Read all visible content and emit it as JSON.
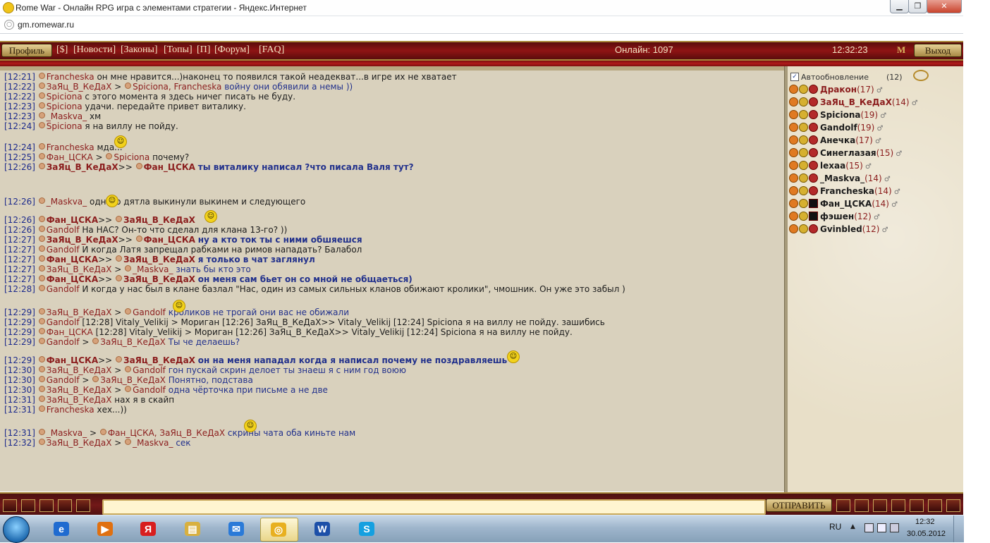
{
  "window": {
    "title": "Rome War - Онлайн RPG игра с элементами стратегии - Яндекс.Интернет",
    "min_label": "▁",
    "max_label": "❐",
    "close_label": "✕"
  },
  "address": {
    "url": "gm.romewar.ru"
  },
  "menu": {
    "profile_label": "Профиль",
    "items": [
      "[$]",
      "[Новости]",
      "[Законы]",
      "[Топы]",
      "[П]",
      "[Форум]",
      "[FAQ]"
    ],
    "online": "Онлайн: 1097",
    "clock": "12:32:23",
    "logo": "M",
    "exit_label": "Выход"
  },
  "chat": {
    "messages": [
      {
        "ts": "[12:21]",
        "from": "Francheska",
        "to": "",
        "text": "он мне нравится...)наконец то появился такой неадекват...в игре их не хватает",
        "style": "plain"
      },
      {
        "ts": "[12:22]",
        "from": "ЗаЯц_В_КеДаХ",
        "to": "Spiciona, Francheska",
        "text": "войну они обявили а немы ))",
        "style": "blue"
      },
      {
        "ts": "[12:22]",
        "from": "Spiciona",
        "to": "",
        "text": "с этого момента я здесь ничег писать не буду.",
        "style": "plain"
      },
      {
        "ts": "[12:23]",
        "from": "Spiciona",
        "to": "",
        "text": "удачи. передайте привет виталику.",
        "style": "plain"
      },
      {
        "ts": "[12:23]",
        "from": "_Maskva_",
        "to": "",
        "text": "хм",
        "style": "plain"
      },
      {
        "ts": "[12:24]",
        "from": "Spiciona",
        "to": "",
        "text": "я на виллу не пойду.",
        "style": "plain"
      },
      {
        "ts": "[12:24]",
        "from": "Francheska",
        "to": "",
        "text": "мда...",
        "style": "plain"
      },
      {
        "ts": "[12:25]",
        "from": "Фан_ЦСКА",
        "to": "Spiciona",
        "text": "почему?",
        "style": "plain"
      },
      {
        "ts": "[12:26]",
        "from": "ЗаЯц_В_КеДаХ",
        "to": "Фан_ЦСКА",
        "text": "ты виталику написал ?что писала Валя тут?",
        "style": "bblue"
      },
      {
        "ts": "[12:26]",
        "from": "_Maskva_",
        "to": "",
        "text": "одного дятла выкинули выкинем и следующего",
        "style": "plain"
      },
      {
        "ts": "[12:26]",
        "from": "Фан_ЦСКА",
        "to": "ЗаЯц_В_КеДаХ",
        "text": "",
        "style": "bred"
      },
      {
        "ts": "[12:26]",
        "from": "Gandolf",
        "to": "",
        "text": "На НАС? Он-то что сделал для клана 13-го? ))",
        "style": "plain"
      },
      {
        "ts": "[12:27]",
        "from": "ЗаЯц_В_КеДаХ",
        "to": "Фан_ЦСКА",
        "text": "ну а кто ток ты с ними обшяешся",
        "style": "bblue"
      },
      {
        "ts": "[12:27]",
        "from": "Gandolf",
        "to": "",
        "text": "И когда Латя запрещал рабками на римов нападать? Балабол",
        "style": "plain"
      },
      {
        "ts": "[12:27]",
        "from": "Фан_ЦСКА",
        "to": "ЗаЯц_В_КеДаХ",
        "text": "я только в чат заглянул",
        "style": "bred"
      },
      {
        "ts": "[12:27]",
        "from": "ЗаЯц_В_КеДаХ",
        "to": "_Maskva_",
        "text": "знать бы кто это",
        "style": "blue"
      },
      {
        "ts": "[12:27]",
        "from": "Фан_ЦСКА",
        "to": "ЗаЯц_В_КеДаХ",
        "text": "он меня сам бьет он со мной не общаеться)",
        "style": "bblue"
      },
      {
        "ts": "[12:28]",
        "from": "Gandolf",
        "to": "",
        "text": "И когда у нас был в клане базлал \"Нас, один из самых сильных кланов обижают  кролики\", чмошник. Он уже это забыл )",
        "style": "plain"
      },
      {
        "ts": "[12:29]",
        "from": "ЗаЯц_В_КеДаХ",
        "to": "Gandolf",
        "text": "кроликов не трогай они вас не обижали",
        "style": "blue"
      },
      {
        "ts": "[12:29]",
        "from": "Gandolf",
        "to": "",
        "text": "[12:28] Vitaly_Velikij > Мориган [12:26] ЗаЯц_В_КеДаХ>>  Vitaly_Velikij [12:24] Spiciona я на виллу не пойду. зашибись",
        "style": "plain"
      },
      {
        "ts": "[12:29]",
        "from": "Фан_ЦСКА",
        "to": "",
        "text": "[12:28] Vitaly_Velikij > Мориган [12:26] ЗаЯц_В_КеДаХ>>  Vitaly_Velikij [12:24] Spiciona я на виллу не пойду.",
        "style": "plain"
      },
      {
        "ts": "[12:29]",
        "from": "Gandolf",
        "to": "ЗаЯц_В_КеДаХ",
        "text": "Ты че делаешь?",
        "style": "blue"
      },
      {
        "ts": "[12:29]",
        "from": "Фан_ЦСКА",
        "to": "ЗаЯц_В_КеДаХ",
        "text": "он на меня нападал когда я написал почему не поздравляешь",
        "style": "bred"
      },
      {
        "ts": "[12:30]",
        "from": "ЗаЯц_В_КеДаХ",
        "to": "Gandolf",
        "text": "гон пускай скрин делоет ты знаеш я с ним год воюю",
        "style": "blue"
      },
      {
        "ts": "[12:30]",
        "from": "Gandolf",
        "to": "ЗаЯц_В_КеДаХ",
        "text": "Понятно, подстава",
        "style": "blue"
      },
      {
        "ts": "[12:30]",
        "from": "ЗаЯц_В_КеДаХ",
        "to": "Gandolf",
        "text": "одна чёрточка при письме а не две",
        "style": "blue"
      },
      {
        "ts": "[12:31]",
        "from": "ЗаЯц_В_КеДаХ",
        "to": "",
        "text": "нах я в скайп",
        "style": "plain"
      },
      {
        "ts": "[12:31]",
        "from": "Francheska",
        "to": "",
        "text": "хех...))",
        "style": "plain"
      },
      {
        "ts": "[12:31]",
        "from": "_Maskva_",
        "to": "Фан_ЦСКА, ЗаЯц_В_КеДаХ",
        "text": "скрины чата оба киньте нам",
        "style": "blue"
      },
      {
        "ts": "[12:32]",
        "from": "ЗаЯц_В_КеДаХ",
        "to": "_Maskva_",
        "text": "сек",
        "style": "blue"
      }
    ]
  },
  "panel": {
    "autoupdate_label": "Автообновление",
    "autoupdate_checked": "✓",
    "count": "(12)",
    "users": [
      {
        "name": "Дракон",
        "level": "(17)",
        "icon3": "red",
        "dark": false
      },
      {
        "name": "ЗаЯц_В_КеДаХ",
        "level": "(14)",
        "icon3": "red",
        "dark": false
      },
      {
        "name": "Spiciona",
        "level": "(19)",
        "icon3": "red",
        "dark": true
      },
      {
        "name": "Gandolf",
        "level": "(19)",
        "icon3": "red",
        "dark": true
      },
      {
        "name": "Анечка",
        "level": "(17)",
        "icon3": "red",
        "dark": true
      },
      {
        "name": "Синеглазая",
        "level": "(15)",
        "icon3": "red",
        "dark": true
      },
      {
        "name": "lexaa",
        "level": "(15)",
        "icon3": "red",
        "dark": true
      },
      {
        "name": "_Maskva_",
        "level": "(14)",
        "icon3": "red",
        "dark": true
      },
      {
        "name": "Francheska",
        "level": "(14)",
        "icon3": "red",
        "dark": true
      },
      {
        "name": "Фан_ЦСКА",
        "level": "(14)",
        "icon3": "black",
        "dark": true
      },
      {
        "name": "фэшен",
        "level": "(12)",
        "icon3": "black",
        "dark": true
      },
      {
        "name": "Gvinbled",
        "level": "(12)",
        "icon3": "red",
        "dark": true
      }
    ]
  },
  "inputbar": {
    "send_label": "ОТПРАВИТЬ",
    "input_value": ""
  },
  "taskbar": {
    "apps": [
      {
        "name": "ie-icon",
        "glyph": "e",
        "color": "#1f6bd0"
      },
      {
        "name": "media-player-icon",
        "glyph": "▶",
        "color": "#e07010"
      },
      {
        "name": "yandex-icon",
        "glyph": "Я",
        "color": "#d81e1e"
      },
      {
        "name": "explorer-icon",
        "glyph": "▤",
        "color": "#d8b040"
      },
      {
        "name": "mail-icon",
        "glyph": "✉",
        "color": "#2a7ad8"
      },
      {
        "name": "yandex-browser-icon",
        "glyph": "◎",
        "color": "#e8b020"
      },
      {
        "name": "word-icon",
        "glyph": "W",
        "color": "#1c4fa8"
      },
      {
        "name": "skype-icon",
        "glyph": "S",
        "color": "#15a0e0"
      }
    ],
    "lang": "RU",
    "time": "12:32",
    "date": "30.05.2012"
  },
  "colors": {
    "nick": "#8b1d1d",
    "timestamp": "#1c2a8c",
    "blue_text": "#22318c",
    "chat_bg": "#d9d1bd"
  }
}
